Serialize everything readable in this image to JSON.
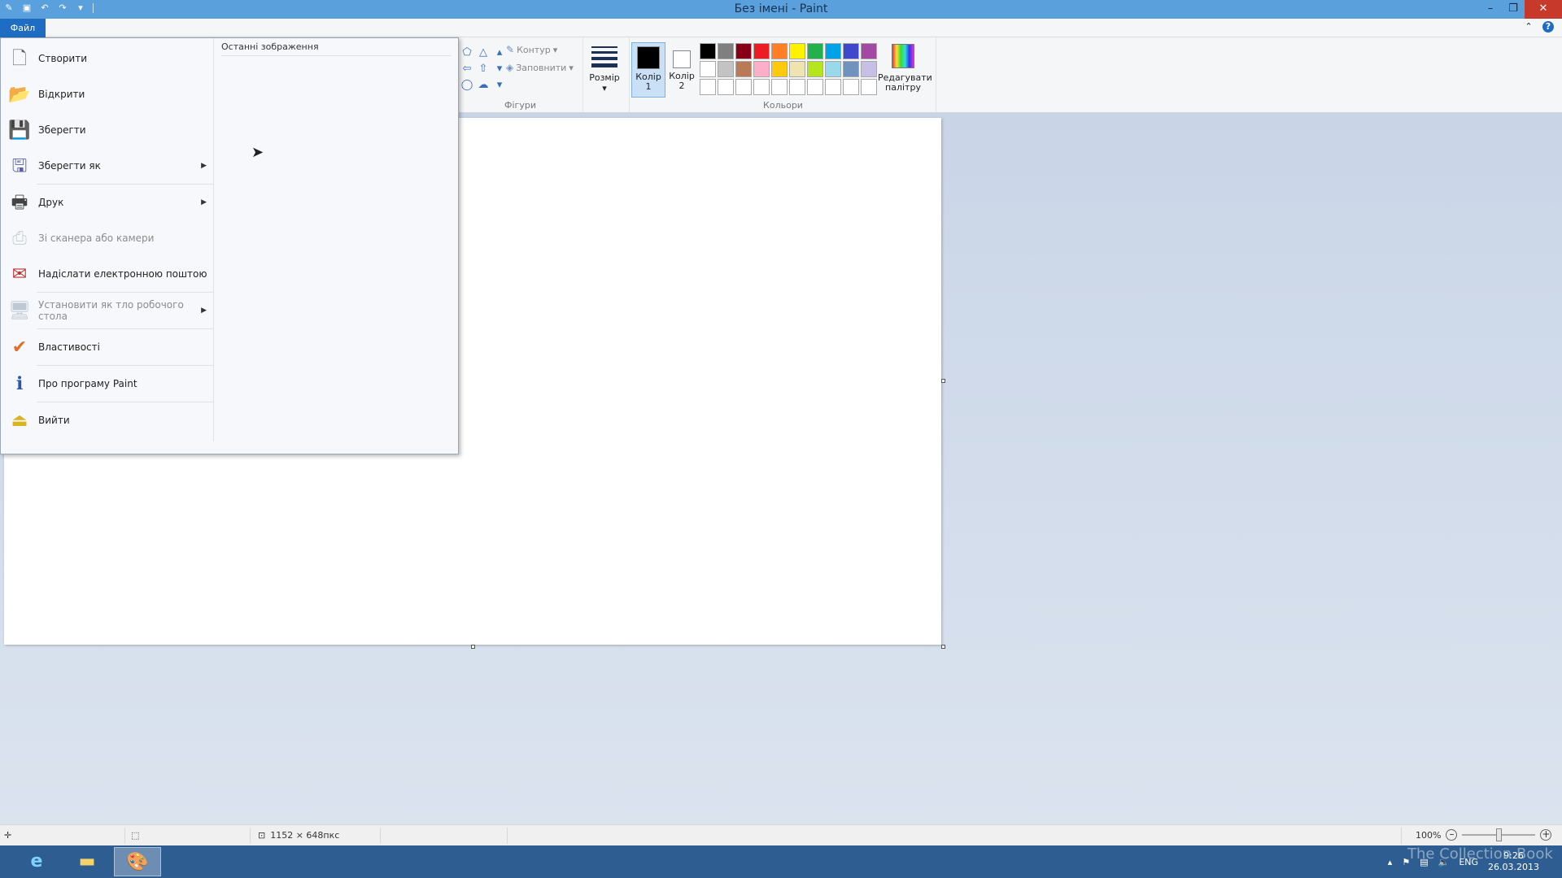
{
  "window": {
    "title": "Без імені - Paint"
  },
  "ribbon": {
    "file_tab": "Файл",
    "shapes": {
      "outline_label": "Контур",
      "fill_label": "Заповнити",
      "group_label": "Фігури"
    },
    "size_label": "Розмір",
    "color1_label": "Колір 1",
    "color2_label": "Колір 2",
    "colors_group_label": "Кольори",
    "edit_palette_label": "Редагувати палітру",
    "palette_colors": [
      "#000000",
      "#7f7f7f",
      "#880015",
      "#ed1c24",
      "#ff7f27",
      "#fff200",
      "#22b14c",
      "#00a2e8",
      "#3f48cc",
      "#a349a4",
      "#ffffff",
      "#c3c3c3",
      "#b97a57",
      "#ffaec9",
      "#ffc90e",
      "#efe4b0",
      "#b5e61d",
      "#99d9ea",
      "#7092be",
      "#c8bfe7",
      "#ffffff",
      "#ffffff",
      "#ffffff",
      "#ffffff",
      "#ffffff",
      "#ffffff",
      "#ffffff",
      "#ffffff",
      "#ffffff",
      "#ffffff"
    ],
    "color1": "#000000",
    "color2": "#ffffff"
  },
  "file_menu": {
    "items": [
      {
        "label": "Створити",
        "icon": "new-file-icon",
        "disabled": false,
        "submenu": false
      },
      {
        "label": "Відкрити",
        "icon": "open-folder-icon",
        "disabled": false,
        "submenu": false
      },
      {
        "label": "Зберегти",
        "icon": "save-disk-icon",
        "disabled": false,
        "submenu": false
      },
      {
        "label": "Зберегти як",
        "icon": "save-as-icon",
        "disabled": false,
        "submenu": true
      },
      {
        "label": "Друк",
        "icon": "printer-icon",
        "disabled": false,
        "submenu": true
      },
      {
        "label": "Зі сканера або камери",
        "icon": "scanner-icon",
        "disabled": true,
        "submenu": false
      },
      {
        "label": "Надіслати електронною поштою",
        "icon": "email-icon",
        "disabled": false,
        "submenu": false
      },
      {
        "label": "Установити як тло робочого стола",
        "icon": "desktop-background-icon",
        "disabled": true,
        "submenu": true
      },
      {
        "label": "Властивості",
        "icon": "properties-check-icon",
        "disabled": false,
        "submenu": false
      },
      {
        "label": "Про програму Paint",
        "icon": "info-icon",
        "disabled": false,
        "submenu": false
      },
      {
        "label": "Вийти",
        "icon": "exit-icon",
        "disabled": false,
        "submenu": false
      }
    ],
    "recent_title": "Останні зображення"
  },
  "status": {
    "dimensions": "1152 × 648пкс",
    "zoom": "100%"
  },
  "tray": {
    "language": "ENG",
    "time": "9:26",
    "date": "26.03.2013"
  },
  "watermark": "The Collection Book"
}
